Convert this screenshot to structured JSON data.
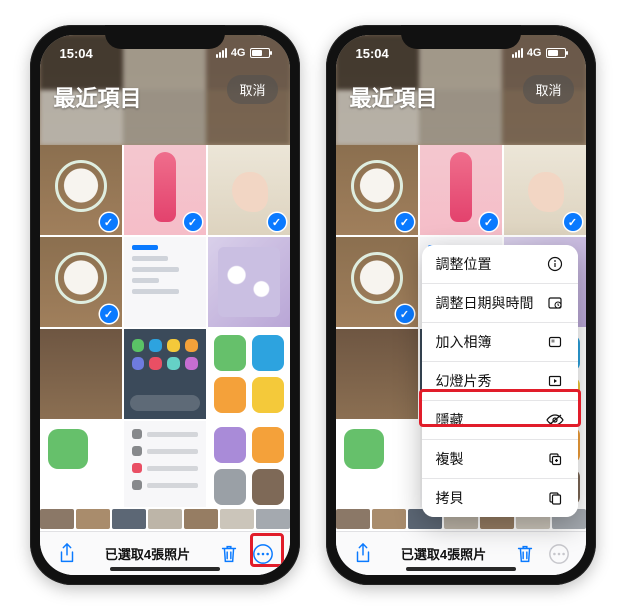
{
  "status": {
    "time": "15:04",
    "network": "4G"
  },
  "header": {
    "title": "最近項目",
    "cancel": "取消"
  },
  "toolbar": {
    "count_text": "已選取4張照片"
  },
  "menu": {
    "adjust_location": "調整位置",
    "adjust_datetime": "調整日期與時間",
    "add_to_album": "加入相簿",
    "slideshow": "幻燈片秀",
    "hide": "隱藏",
    "duplicate": "複製",
    "copy": "拷貝"
  }
}
